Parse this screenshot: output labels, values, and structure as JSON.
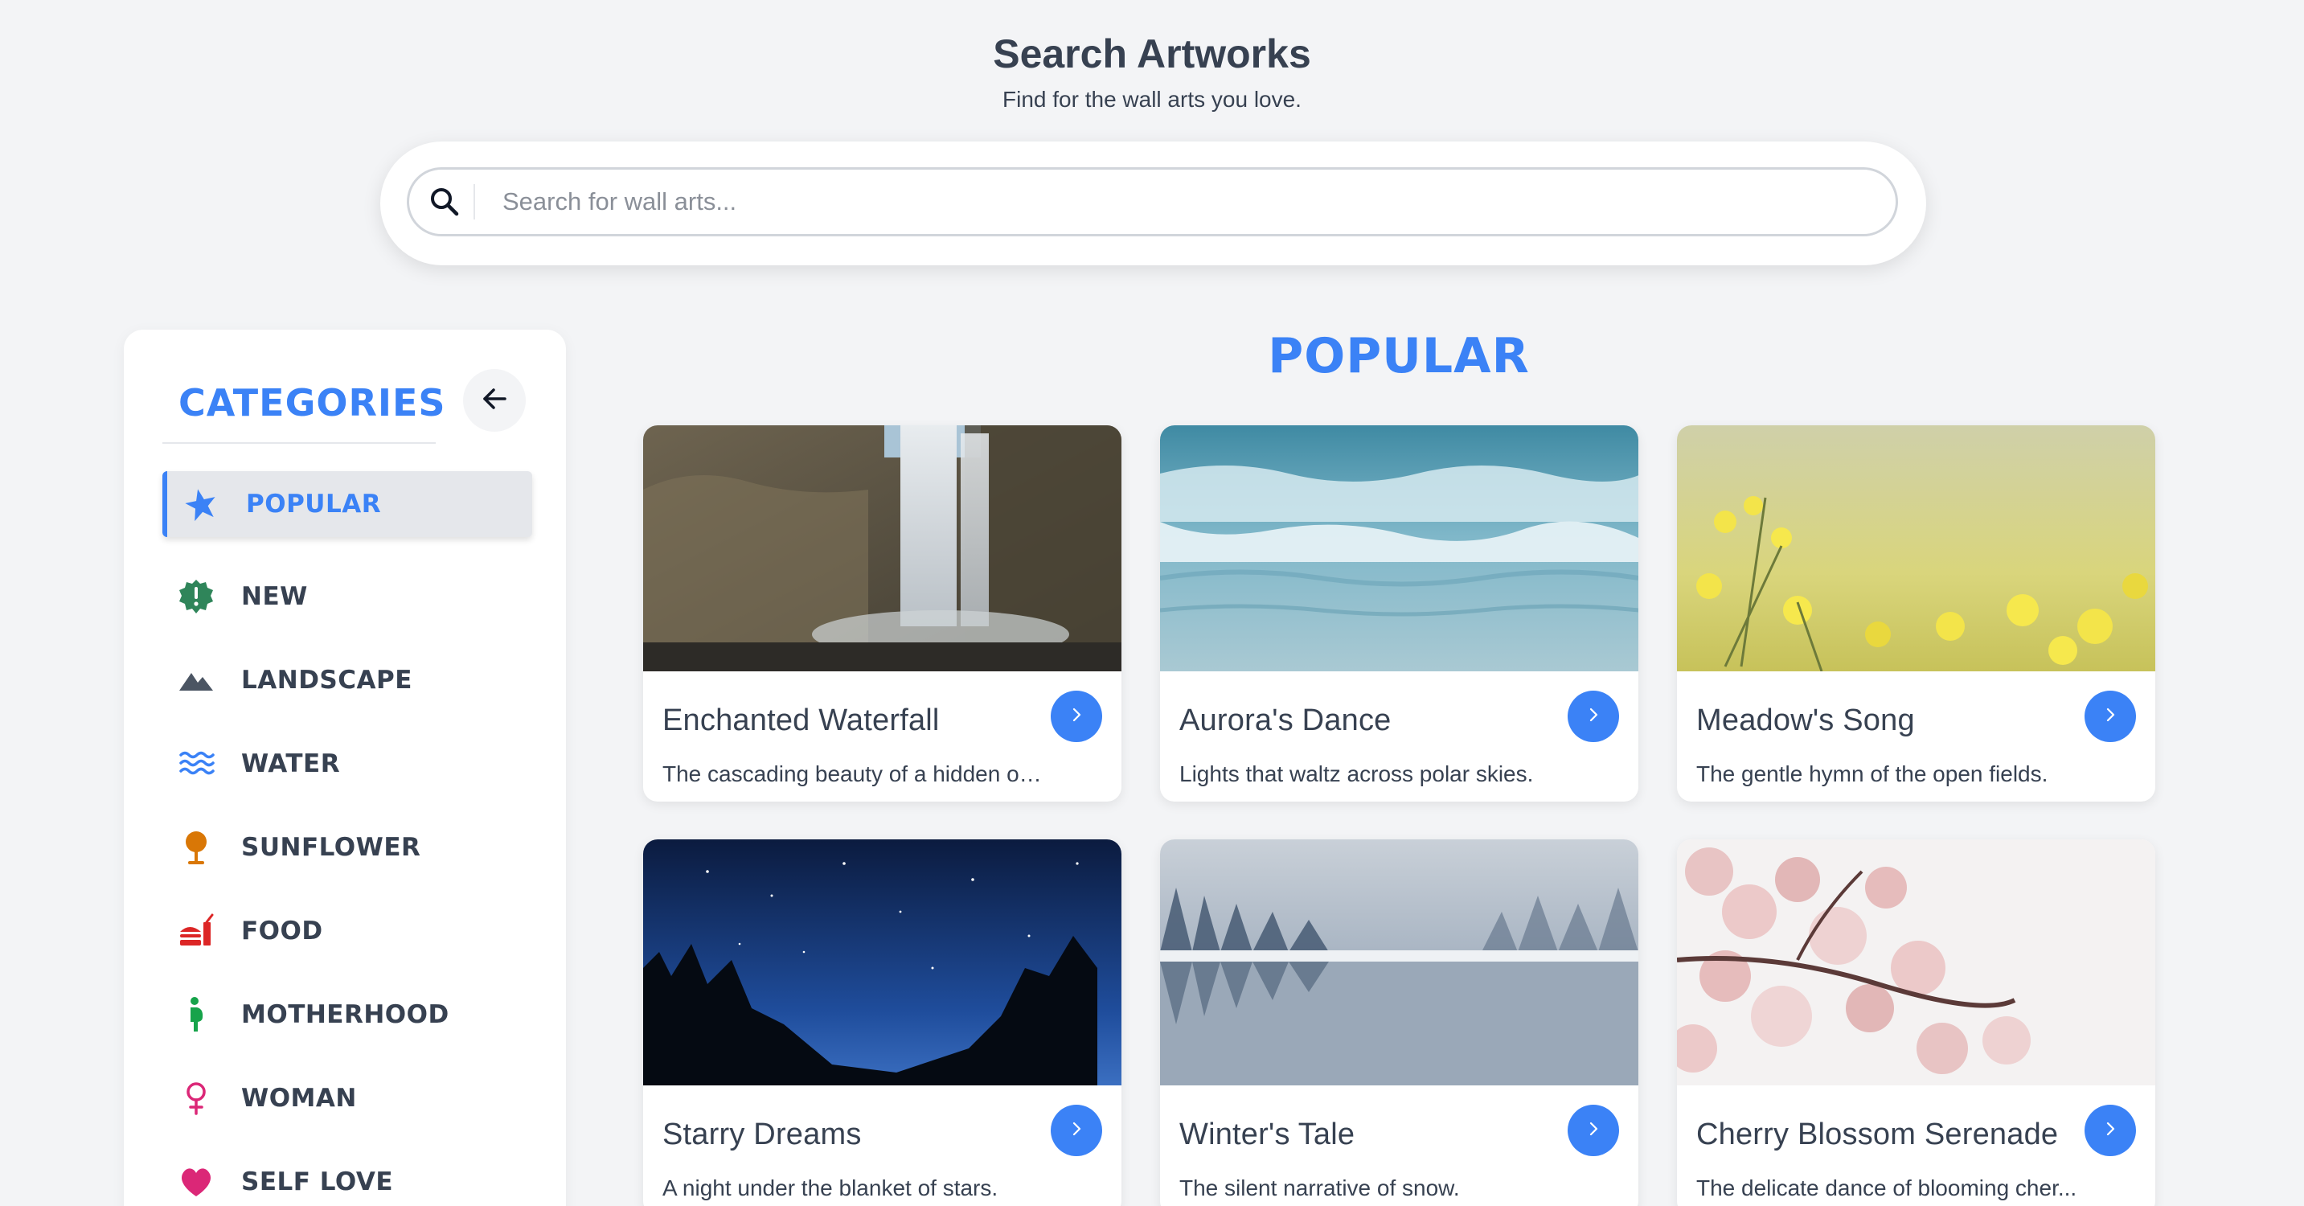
{
  "header": {
    "title": "Search Artworks",
    "subtitle": "Find for the wall arts you love."
  },
  "search": {
    "placeholder": "Search for wall arts...",
    "value": ""
  },
  "sidebar": {
    "title": "CATEGORIES",
    "items": [
      {
        "label": "POPULAR",
        "icon": "star-icon",
        "color": "#3b82f6",
        "active": true
      },
      {
        "label": "NEW",
        "icon": "badge-alert-icon",
        "color": "#2f855a"
      },
      {
        "label": "LANDSCAPE",
        "icon": "mountain-icon",
        "color": "#4b5563"
      },
      {
        "label": "WATER",
        "icon": "water-waves-icon",
        "color": "#3b82f6"
      },
      {
        "label": "SUNFLOWER",
        "icon": "sunflower-icon",
        "color": "#d97706"
      },
      {
        "label": "FOOD",
        "icon": "food-icon",
        "color": "#dc2626"
      },
      {
        "label": "MOTHERHOOD",
        "icon": "person-pregnant-icon",
        "color": "#16a34a"
      },
      {
        "label": "WOMAN",
        "icon": "venus-icon",
        "color": "#db2777"
      },
      {
        "label": "SELF LOVE",
        "icon": "heart-icon",
        "color": "#db2777"
      }
    ]
  },
  "main": {
    "section_title": "POPULAR",
    "cards": [
      {
        "title": "Enchanted Waterfall",
        "description": "The cascading beauty of a hidden oa..."
      },
      {
        "title": "Aurora's Dance",
        "description": "Lights that waltz across polar skies."
      },
      {
        "title": "Meadow's Song",
        "description": "The gentle hymn of the open fields."
      },
      {
        "title": "Starry Dreams",
        "description": "A night under the blanket of stars."
      },
      {
        "title": "Winter's Tale",
        "description": "The silent narrative of snow."
      },
      {
        "title": "Cherry Blossom Serenade",
        "description": "The delicate dance of blooming cher..."
      }
    ]
  },
  "colors": {
    "accent": "#3b82f6",
    "background": "#f3f4f6",
    "text": "#374151"
  }
}
